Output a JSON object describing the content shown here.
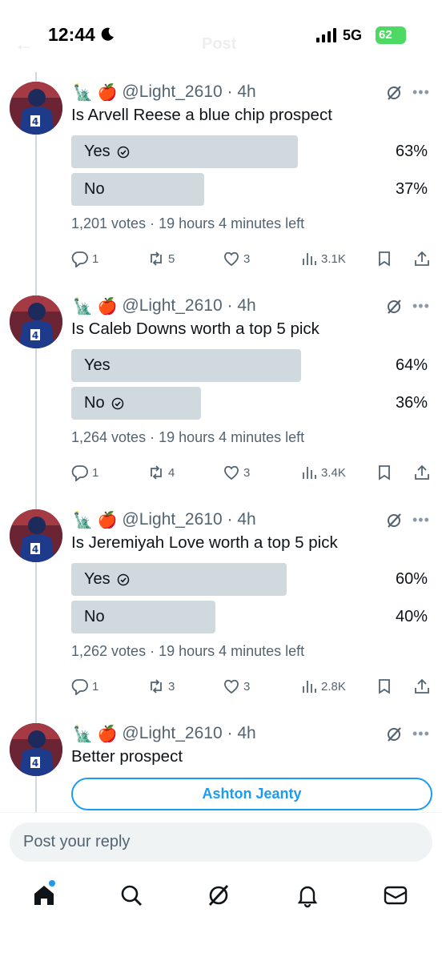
{
  "status_bar": {
    "time": "12:44",
    "network": "5G",
    "battery": "62"
  },
  "header": {
    "title": "Post"
  },
  "posts": [
    {
      "handle": "@Light_2610",
      "time": "4h",
      "emoji": "🗽 🍎",
      "text": "Is Arvell Reese a blue chip prospect",
      "poll": {
        "options": [
          {
            "label": "Yes",
            "percent": "63%",
            "fill": 63,
            "selected": true
          },
          {
            "label": "No",
            "percent": "37%",
            "fill": 37,
            "selected": false
          }
        ],
        "meta": "1,201 votes · 19 hours 4 minutes left"
      },
      "actions": {
        "replies": "1",
        "reposts": "5",
        "likes": "3",
        "views": "3.1K"
      }
    },
    {
      "handle": "@Light_2610",
      "time": "4h",
      "emoji": "🗽 🍎",
      "text": "Is Caleb Downs worth a top 5 pick",
      "poll": {
        "options": [
          {
            "label": "Yes",
            "percent": "64%",
            "fill": 64,
            "selected": false
          },
          {
            "label": "No",
            "percent": "36%",
            "fill": 36,
            "selected": true
          }
        ],
        "meta": "1,264 votes · 19 hours 4 minutes left"
      },
      "actions": {
        "replies": "1",
        "reposts": "4",
        "likes": "3",
        "views": "3.4K"
      }
    },
    {
      "handle": "@Light_2610",
      "time": "4h",
      "emoji": "🗽 🍎",
      "text": "Is Jeremiyah Love worth a top 5 pick",
      "poll": {
        "options": [
          {
            "label": "Yes",
            "percent": "60%",
            "fill": 60,
            "selected": true
          },
          {
            "label": "No",
            "percent": "40%",
            "fill": 40,
            "selected": false
          }
        ],
        "meta": "1,262 votes · 19 hours 4 minutes left"
      },
      "actions": {
        "replies": "1",
        "reposts": "3",
        "likes": "3",
        "views": "2.8K"
      }
    },
    {
      "handle": "@Light_2610",
      "time": "4h",
      "emoji": "🗽 🍎",
      "text": "Better prospect",
      "poll_choice": "Ashton Jeanty"
    }
  ],
  "reply": {
    "placeholder": "Post your reply"
  },
  "tabs": [
    "home-icon",
    "search-icon",
    "grok-icon",
    "notifications-icon",
    "messages-icon"
  ],
  "colors": {
    "accent": "#1d9bf0",
    "poll_bar": "#cfd9de",
    "secondary_text": "#536471"
  }
}
